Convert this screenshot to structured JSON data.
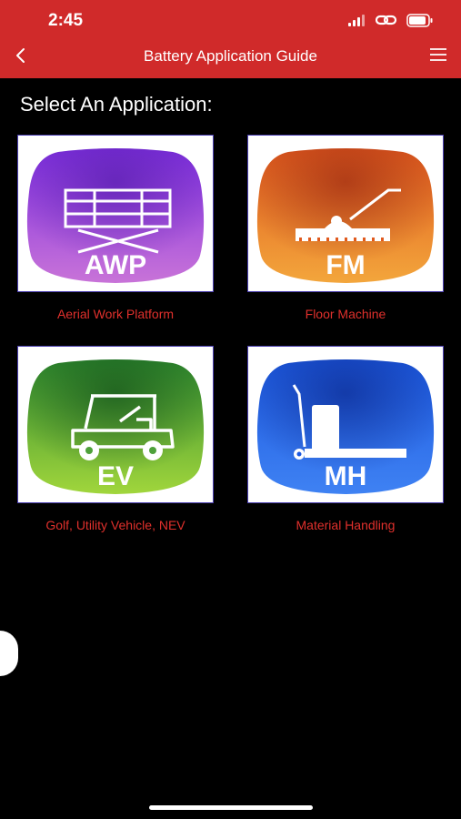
{
  "status_bar": {
    "time": "2:45",
    "icons": [
      "cellular-signal-icon",
      "personal-hotspot-icon",
      "battery-icon"
    ]
  },
  "nav": {
    "title": "Battery Application Guide",
    "back_icon": "chevron-left-icon",
    "menu_icon": "hamburger-menu-icon"
  },
  "heading": "Select An Application:",
  "applications": [
    {
      "code": "AWP",
      "label": "Aerial Work Platform",
      "icon": "aerial-work-platform-icon",
      "color_top": "#8a3fe6",
      "color_bottom": "#c06ad8"
    },
    {
      "code": "FM",
      "label": "Floor Machine",
      "icon": "floor-machine-icon",
      "color_top": "#e0521e",
      "color_bottom": "#f2a33a"
    },
    {
      "code": "EV",
      "label": "Golf, Utility Vehicle, NEV",
      "icon": "golf-cart-icon",
      "color_top": "#2e8a2e",
      "color_bottom": "#9ed43a"
    },
    {
      "code": "MH",
      "label": "Material Handling",
      "icon": "pallet-jack-icon",
      "color_top": "#1f5fe0",
      "color_bottom": "#3f7ff2"
    }
  ],
  "colors": {
    "header_bg": "#d02a2a",
    "label_red": "#e0302c",
    "background": "#000000"
  }
}
